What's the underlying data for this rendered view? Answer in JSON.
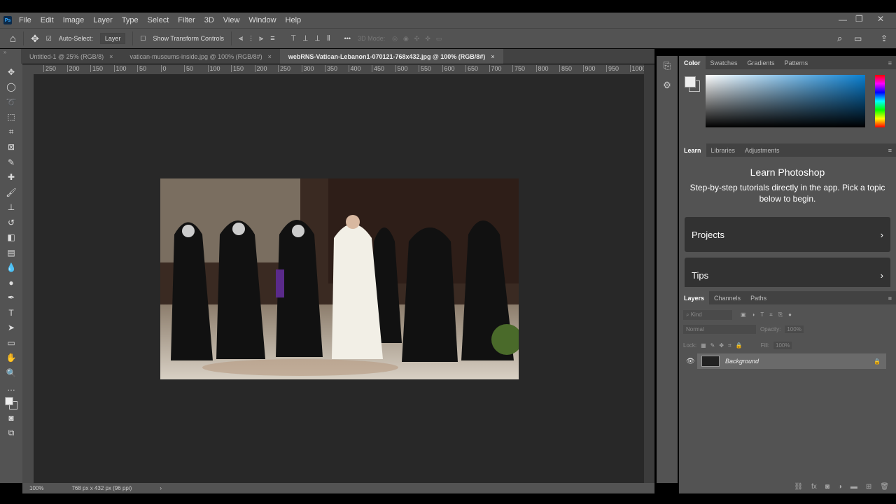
{
  "menu": {
    "logo": "Ps",
    "items": [
      "File",
      "Edit",
      "Image",
      "Layer",
      "Type",
      "Select",
      "Filter",
      "3D",
      "View",
      "Window",
      "Help"
    ]
  },
  "options": {
    "auto_select_label": "Auto-Select:",
    "layer_select": "Layer",
    "show_transform": "Show Transform Controls",
    "mode3d": "3D Mode:",
    "more": "•••"
  },
  "tabs": [
    {
      "label": "Untitled-1 @ 25% (RGB/8)"
    },
    {
      "label": "vatican-museums-inside.jpg @ 100% (RGB/8#)"
    },
    {
      "label": "webRNS-Vatican-Lebanon1-070121-768x432.jpg @ 100% (RGB/8#)"
    }
  ],
  "ruler_h": [
    "250",
    "200",
    "150",
    "100",
    "50",
    "0",
    "50",
    "100",
    "150",
    "200",
    "250",
    "300",
    "350",
    "400",
    "450",
    "500",
    "550",
    "600",
    "650",
    "700",
    "750",
    "800",
    "850",
    "900",
    "950",
    "1000"
  ],
  "status": {
    "zoom": "100%",
    "doc": "768 px x 432 px (96 ppi)",
    "arrow": "›"
  },
  "color_panel": {
    "tabs": [
      "Color",
      "Swatches",
      "Gradients",
      "Patterns"
    ]
  },
  "learn_panel": {
    "tabs": [
      "Learn",
      "Libraries",
      "Adjustments"
    ],
    "title": "Learn Photoshop",
    "subtitle": "Step-by-step tutorials directly in the app. Pick a topic below to begin.",
    "cards": [
      "Projects",
      "Tips"
    ]
  },
  "layers_panel": {
    "tabs": [
      "Layers",
      "Channels",
      "Paths"
    ],
    "kind": "Kind",
    "blend": "Normal",
    "opacity_label": "Opacity:",
    "opacity": "100%",
    "lock_label": "Lock:",
    "fill_label": "Fill:",
    "fill": "100%",
    "layers": [
      {
        "name": "Background",
        "visible": true,
        "locked": true
      }
    ]
  }
}
